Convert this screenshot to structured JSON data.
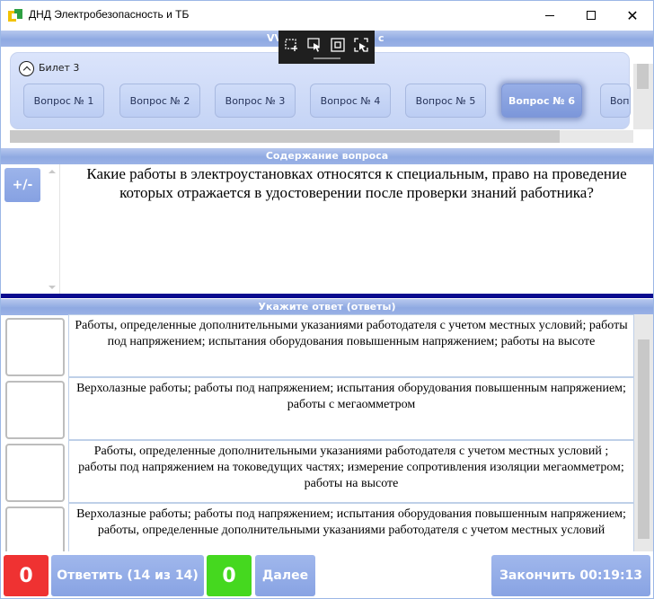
{
  "window": {
    "title": "ДНД Электробезопасность и ТБ",
    "min_icon": "minimize-icon",
    "max_icon": "maximize-icon",
    "close_symbol": "✕"
  },
  "sections": {
    "questions_header_visible": "VV",
    "questions_header_tail": "с",
    "content_header": "Содержание вопроса",
    "answers_header": "Укажите ответ (ответы)"
  },
  "ticket": {
    "label": "Билет  3",
    "questions": [
      {
        "label": "Вопрос № 1",
        "active": false
      },
      {
        "label": "Вопрос № 2",
        "active": false
      },
      {
        "label": "Вопрос № 3",
        "active": false
      },
      {
        "label": "Вопрос № 4",
        "active": false
      },
      {
        "label": "Вопрос № 5",
        "active": false
      },
      {
        "label": "Вопрос № 6",
        "active": true
      },
      {
        "label": "Вопр",
        "active": false
      }
    ]
  },
  "question": {
    "toggle_label": "+/-",
    "text": "Какие работы в электроустановках относятся к специальным, право на проведение которых отражается в удостоверении после проверки знаний работника?"
  },
  "answers": [
    {
      "text": "Работы, определенные дополнительными указаниями работодателя с учетом местных условий; работы под напряжением; испытания оборудования повышенным напряжением; работы на высоте",
      "checked": false
    },
    {
      "text": "Верхолазные работы; работы под напряжением; испытания оборудования повышенным напряжением; работы с мегаомметром",
      "checked": false
    },
    {
      "text": "Работы, определенные дополнительными указаниями работодателя с учетом местных условий ; работы под напряжением на токоведущих частях; измерение сопротивления изоляции мегаомметром; работы на высоте",
      "checked": false
    },
    {
      "text": "Верхолазные работы; работы под напряжением; испытания оборудования повышенным напряжением; работы, определенные дополнительными указаниями работодателя с учетом местных условий",
      "checked": false
    }
  ],
  "bottom": {
    "wrong_count": "0",
    "answer_label": "Ответить (14 из 14)",
    "right_count": "0",
    "next_label": "Далее",
    "finish_label": "Закончить  00:19:13"
  },
  "colors": {
    "header_bar": "#8fa9e2",
    "active_question": "#7c97da",
    "wrong": "#ef3232",
    "right": "#45d81f",
    "divider": "#0b0b8f"
  }
}
